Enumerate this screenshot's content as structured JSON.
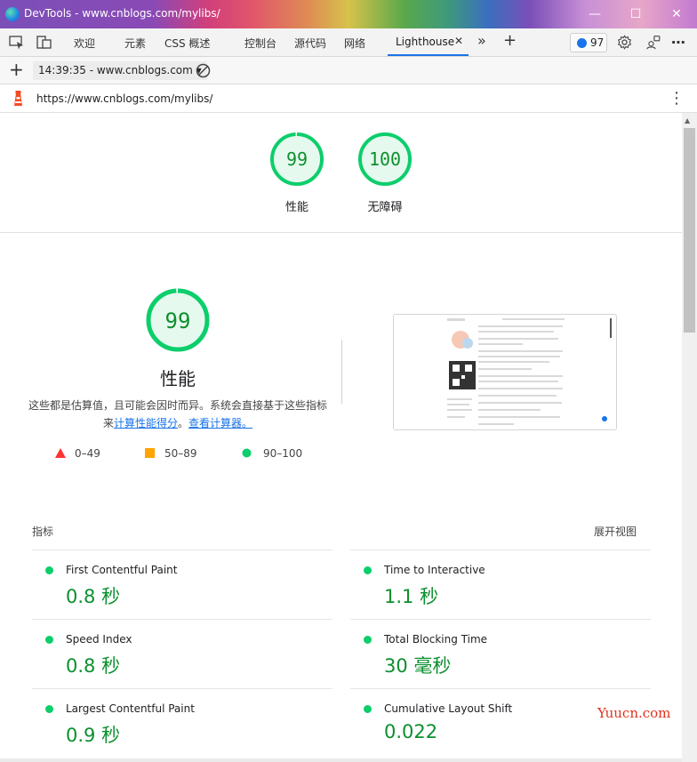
{
  "window": {
    "title": "DevTools - www.cnblogs.com/mylibs/",
    "minimize_glyph": "—",
    "maximize_glyph": "☐",
    "close_glyph": "✕"
  },
  "tabs": {
    "items": [
      {
        "label": "欢迎"
      },
      {
        "label": "元素"
      },
      {
        "label": "CSS 概述"
      },
      {
        "label": "控制台"
      },
      {
        "label": "源代码"
      },
      {
        "label": "网络"
      },
      {
        "label": "Lighthouse"
      }
    ],
    "active": "Lighthouse",
    "issues_count": "97",
    "more_glyph": "»",
    "add_glyph": "+",
    "close_tab_glyph": "✕"
  },
  "lighthouse_toolbar": {
    "report_select": "14:39:35 - www.cnblogs.com",
    "add_glyph": "+",
    "dropdown_glyph": "▾"
  },
  "urlbar": {
    "url": "https://www.cnblogs.com/mylibs/",
    "menu_glyph": "⋮"
  },
  "summary_gauges": [
    {
      "score": "99",
      "label": "性能",
      "fraction": 0.99
    },
    {
      "score": "100",
      "label": "无障碍",
      "fraction": 1.0
    }
  ],
  "performance": {
    "score": "99",
    "fraction": 0.99,
    "title": "性能",
    "desc_text": "这些都是估算值，且可能会因时而异。系统会直接基于这些指标来",
    "link_calc": "计算性能得分",
    "desc_sep": "。",
    "link_calculator": "查看计算器。"
  },
  "legend": [
    {
      "range": "0–49",
      "shape": "triangle",
      "color": "#ff3333"
    },
    {
      "range": "50–89",
      "shape": "square",
      "color": "#ffa400"
    },
    {
      "range": "90–100",
      "shape": "circle",
      "color": "#0cce6b"
    }
  ],
  "metrics": {
    "heading": "指标",
    "expand_label": "展开视图",
    "items": [
      {
        "name": "First Contentful Paint",
        "value": "0.8 秒"
      },
      {
        "name": "Time to Interactive",
        "value": "1.1 秒"
      },
      {
        "name": "Speed Index",
        "value": "0.8 秒"
      },
      {
        "name": "Total Blocking Time",
        "value": "30 毫秒"
      },
      {
        "name": "Largest Contentful Paint",
        "value": "0.9 秒"
      },
      {
        "name": "Cumulative Layout Shift",
        "value": "0.022"
      }
    ]
  },
  "watermark": "Yuucn.com",
  "colors": {
    "pass": "#0cce6b",
    "pass_fill": "#e6f9ee",
    "pass_text": "#0c8f2e",
    "link": "#1a73e8",
    "accent": "#1a73e8"
  }
}
